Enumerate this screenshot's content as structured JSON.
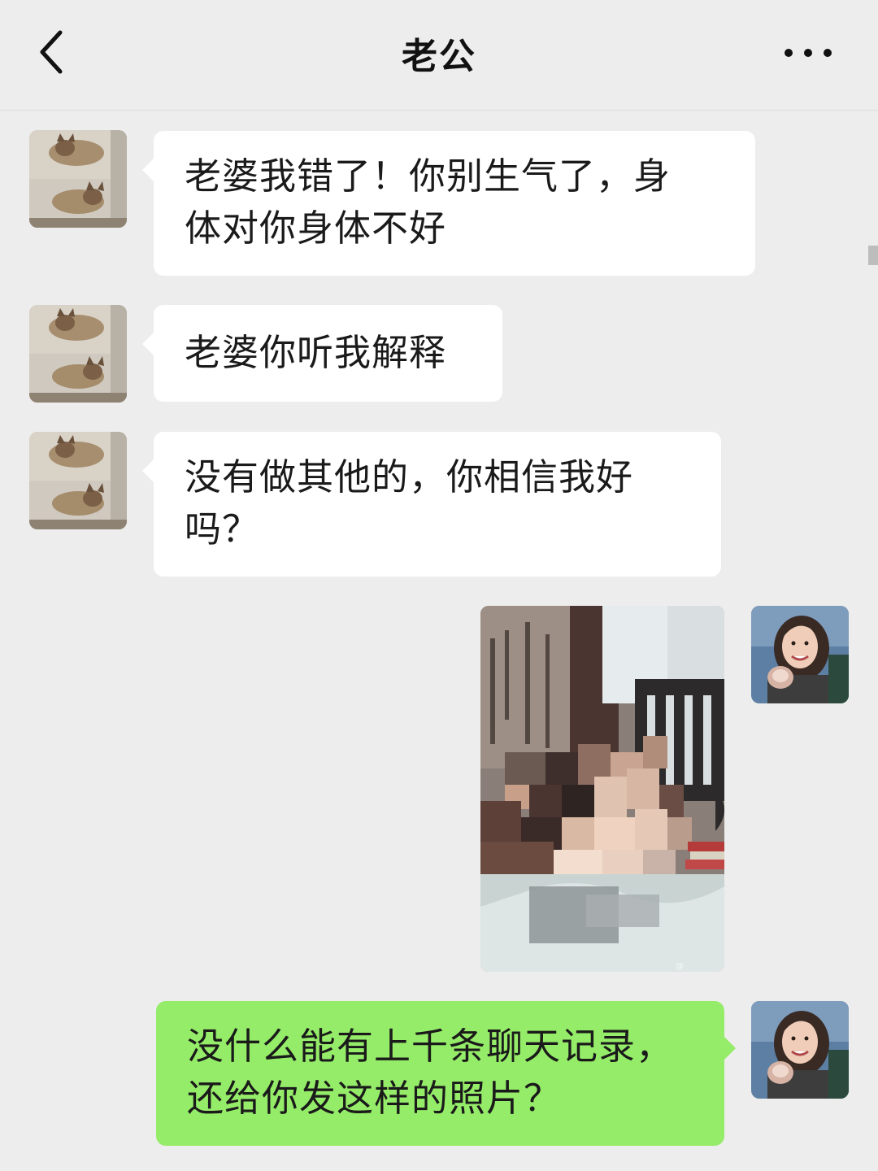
{
  "header": {
    "title": "老公",
    "back_icon": "chevron-left-icon",
    "more_icon": "more-dots-icon"
  },
  "messages": [
    {
      "sender": "contact",
      "type": "text",
      "text": "老婆我错了！你别生气了，身体对你身体不好",
      "line1": "老婆我错了！你别生气了，身",
      "line2": "体对你身体不好"
    },
    {
      "sender": "contact",
      "type": "text",
      "text": "老婆你听我解释"
    },
    {
      "sender": "contact",
      "type": "text",
      "text": "没有做其他的，你相信我好吗？",
      "line1": "没有做其他的，你相信我好",
      "line2": "吗？"
    },
    {
      "sender": "self",
      "type": "image",
      "content": "pixelated photo"
    },
    {
      "sender": "self",
      "type": "text",
      "text": "没什么能有上千条聊天记录，还给你发这样的照片？",
      "line1": "没什么能有上千条聊天记录，",
      "line2": "还给你发这样的照片？"
    }
  ],
  "colors": {
    "background": "#ededed",
    "incoming_bubble": "#ffffff",
    "outgoing_bubble": "#95ec69"
  }
}
